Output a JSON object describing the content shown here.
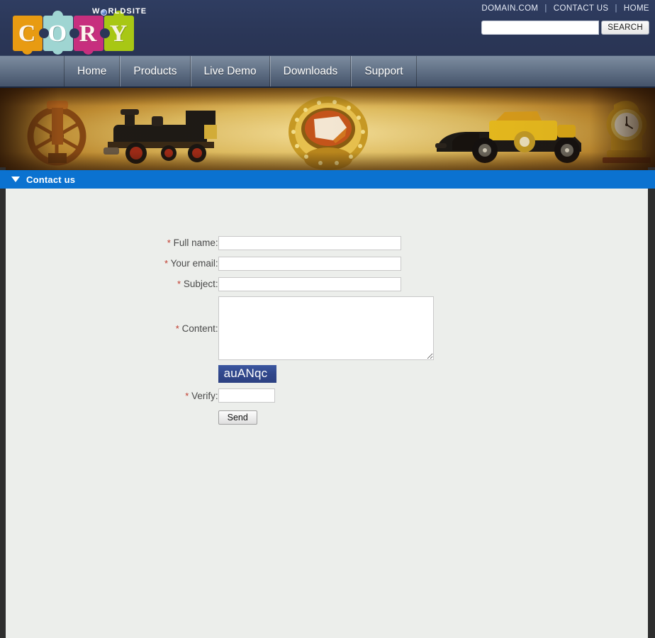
{
  "header": {
    "logo": {
      "tagline": "WORLDSITE",
      "tagline_pre": "W",
      "tagline_post": "RLDSITE",
      "letters": [
        "C",
        "O",
        "R",
        "Y"
      ],
      "colors": [
        "#e89b12",
        "#9fd5d2",
        "#c72f7e",
        "#a8c714"
      ]
    },
    "toplinks": [
      {
        "label": "DOMAIN.COM"
      },
      {
        "label": "CONTACT US"
      },
      {
        "label": "HOME"
      }
    ],
    "separator": "|",
    "search": {
      "value": "",
      "placeholder": "",
      "button_label": "SEARCH"
    }
  },
  "nav": {
    "items": [
      {
        "label": "Home"
      },
      {
        "label": "Products"
      },
      {
        "label": "Live Demo"
      },
      {
        "label": "Downloads"
      },
      {
        "label": "Support"
      }
    ]
  },
  "banner": {
    "alt": "antique collectibles banner: flywheel machine, steam locomotive, gemstone ring, vintage yellow car, mantel clock"
  },
  "section": {
    "title": "Contact us"
  },
  "form": {
    "required_marker": "*",
    "fields": [
      {
        "label": "Full name:",
        "value": "",
        "placeholder": ""
      },
      {
        "label": "Your email:",
        "value": "",
        "placeholder": ""
      },
      {
        "label": "Subject:",
        "value": "",
        "placeholder": ""
      }
    ],
    "content": {
      "label": "Content:",
      "value": "",
      "placeholder": ""
    },
    "captcha": {
      "text": "auANqc",
      "bg_color": "#31478b",
      "fg_color": "#ffffff"
    },
    "verify": {
      "label": "Verify:",
      "value": "",
      "placeholder": ""
    },
    "submit": {
      "label": "Send"
    }
  },
  "colors": {
    "header_bg": "#2b3758",
    "nav_top": "#7d8ca0",
    "nav_bottom": "#45536a",
    "section_bar": "#0b72d0",
    "page_bg": "#eceeeb",
    "rail": "#2e2e2e",
    "required": "#c0392b"
  }
}
